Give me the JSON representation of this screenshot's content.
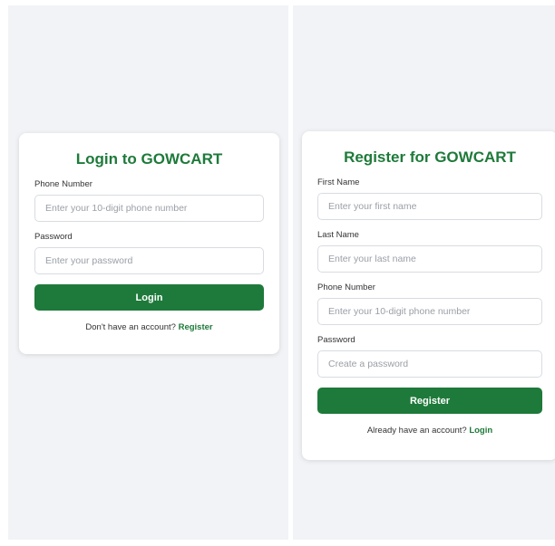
{
  "login": {
    "title": "Login to GOWCART",
    "phone_label": "Phone Number",
    "phone_placeholder": "Enter your 10-digit phone number",
    "password_label": "Password",
    "password_placeholder": "Enter your password",
    "submit_label": "Login",
    "footer_text": "Don't have an account?",
    "footer_link": "Register"
  },
  "register": {
    "title": "Register for GOWCART",
    "first_name_label": "First Name",
    "first_name_placeholder": "Enter your first name",
    "last_name_label": "Last Name",
    "last_name_placeholder": "Enter your last name",
    "phone_label": "Phone Number",
    "phone_placeholder": "Enter your 10-digit phone number",
    "password_label": "Password",
    "password_placeholder": "Create a password",
    "submit_label": "Register",
    "footer_text": "Already have an account?",
    "footer_link": "Login"
  },
  "colors": {
    "brand_green": "#1e7a3a",
    "screen_background": "#f1f3f6",
    "card_background": "#ffffff"
  }
}
